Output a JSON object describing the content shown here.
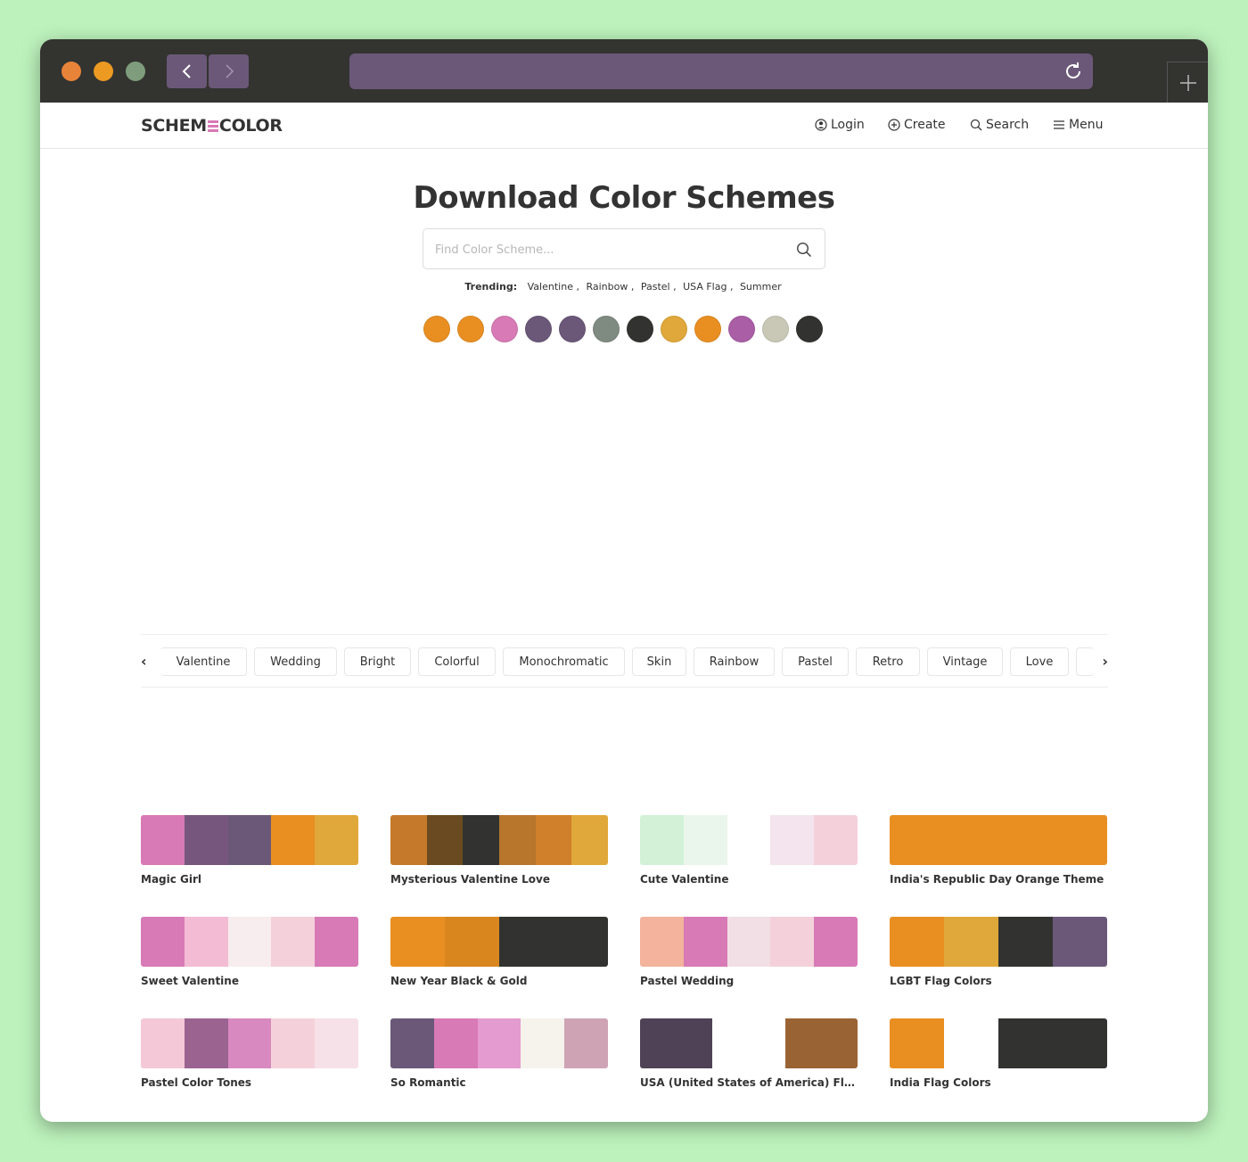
{
  "colors": {
    "accent": "#6b5878",
    "orange": "#e98f22",
    "pink": "#d87ab6",
    "purple": "#6b5878",
    "dark": "#323330",
    "gold": "#e0a83a"
  },
  "window": {
    "traffic_lights": [
      "#e8843a",
      "#ec9a22",
      "#7f9d7c"
    ],
    "back_icon": "chevron-left-icon",
    "forward_icon": "chevron-right-icon",
    "reload_icon": "reload-icon",
    "newtab_icon": "plus-icon"
  },
  "header": {
    "logo_left": "SCHEM",
    "logo_right": "COLOR",
    "nav": [
      {
        "label": "Login",
        "icon": "user-icon"
      },
      {
        "label": "Create",
        "icon": "plus-circle-icon"
      },
      {
        "label": "Search",
        "icon": "search-icon"
      },
      {
        "label": "Menu",
        "icon": "hamburger-icon"
      }
    ]
  },
  "main": {
    "title": "Download Color Schemes",
    "search_placeholder": "Find Color Scheme...",
    "trending_label": "Trending:",
    "trending": [
      "Valentine ,",
      "Rainbow ,",
      "Pastel ,",
      "USA Flag ,",
      "Summer"
    ],
    "palette": [
      "#e98f22",
      "#e98f22",
      "#d87ab6",
      "#6b5878",
      "#6b5878",
      "#7f8a80",
      "#323330",
      "#e0a83a",
      "#e98f22",
      "#a95ea6",
      "#c9c8b7",
      "#323330"
    ]
  },
  "tags": [
    "Valentine",
    "Wedding",
    "Bright",
    "Colorful",
    "Monochromatic",
    "Skin",
    "Rainbow",
    "Pastel",
    "Retro",
    "Vintage",
    "Love"
  ],
  "tag_prev": "‹",
  "tag_next": "›",
  "schemes": [
    {
      "name": "Magic Girl",
      "colors": [
        "#d87ab6",
        "#77567e",
        "#6b5878",
        "#e98f22",
        "#e0a83a"
      ]
    },
    {
      "name": "Mysterious Valentine Love",
      "colors": [
        "#c47a2a",
        "#6a4a20",
        "#323330",
        "#b8752c",
        "#d0802a",
        "#e0a83a"
      ]
    },
    {
      "name": "Cute Valentine",
      "colors": [
        "#d3f1d6",
        "#eaf6ec",
        "#ffffff",
        "#f3e4ed",
        "#f4d1da"
      ]
    },
    {
      "name": "India's Republic Day Orange Theme",
      "colors": [
        "#e98f22"
      ]
    },
    {
      "name": "Sweet Valentine",
      "colors": [
        "#d87ab6",
        "#f3bcd4",
        "#f7ecee",
        "#f4d1da",
        "#d87ab6"
      ]
    },
    {
      "name": "New Year Black & Gold",
      "colors": [
        "#e98f22",
        "#d9861f",
        "#323330",
        "#323330"
      ]
    },
    {
      "name": "Pastel Wedding",
      "colors": [
        "#f3b39c",
        "#d87ab6",
        "#f2dfe5",
        "#f4d1da",
        "#d87ab6"
      ]
    },
    {
      "name": "LGBT Flag Colors",
      "colors": [
        "#e98f22",
        "#e0a83a",
        "#323330",
        "#6b5878"
      ]
    },
    {
      "name": "Pastel Color Tones",
      "colors": [
        "#f4c8d7",
        "#9b6390",
        "#d889bf",
        "#f4d1da",
        "#f7e1e8"
      ]
    },
    {
      "name": "So Romantic",
      "colors": [
        "#6b5878",
        "#d87ab6",
        "#e49bd0",
        "#f6f2ec",
        "#cea3b4"
      ]
    },
    {
      "name": "USA (United States of America) Flag ...",
      "colors": [
        "#4f4256",
        "#ffffff",
        "#9a6334"
      ]
    },
    {
      "name": "India Flag Colors",
      "colors": [
        "#e98f22",
        "#ffffff",
        "#323330",
        "#323330"
      ]
    }
  ]
}
